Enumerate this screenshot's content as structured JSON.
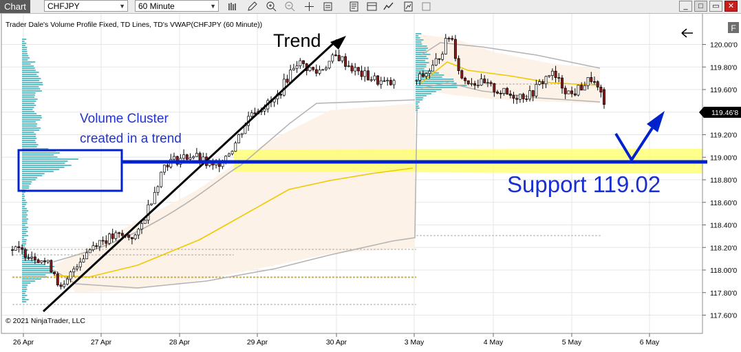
{
  "toolbar": {
    "chart_tab": "Chart",
    "instrument": "CHFJPY",
    "interval": "60 Minute",
    "f_button": "F"
  },
  "chart": {
    "header": "Trader Dale's Volume Profile Fixed, TD Lines, TD's VWAP(CHFJPY (60 Minute))",
    "copyright": "© 2021 NinjaTrader, LLC",
    "last_price": "119.46'8",
    "colors": {
      "up_candle": "#ffffff",
      "down_candle": "#8b1a1a",
      "volume_profile": "#5bc0c8",
      "vwap": "#f0c800",
      "bands": "#b4b4b4",
      "annotation_blue": "#0022cc",
      "highlight_yellow": "#ffff66"
    }
  },
  "annotations": {
    "trend": "Trend",
    "cluster_line1": "Volume Cluster",
    "cluster_line2": "created in a trend",
    "support": "Support 119.02"
  },
  "chart_data": {
    "type": "candlestick",
    "symbol": "CHFJPY",
    "timeframe": "60 Minute",
    "x_labels": [
      "26 Apr",
      "27 Apr",
      "28 Apr",
      "29 Apr",
      "30 Apr",
      "3 May",
      "4 May",
      "5 May",
      "6 May"
    ],
    "y_ticks": [
      "120.00'0",
      "119.80'0",
      "119.60'0",
      "119.40'0",
      "119.20'0",
      "119.00'0",
      "118.80'0",
      "118.60'0",
      "118.40'0",
      "118.20'0",
      "118.00'0",
      "117.80'0",
      "117.60'0"
    ],
    "ylim": [
      117.55,
      120.2
    ],
    "support_level": 119.02,
    "last_price": 119.468
  }
}
